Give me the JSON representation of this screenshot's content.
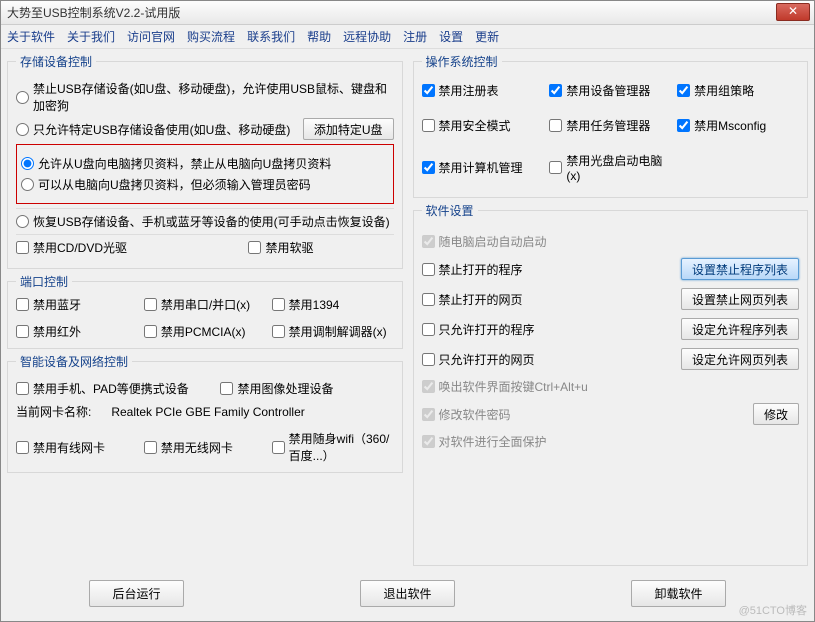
{
  "window": {
    "title": "大势至USB控制系统V2.2-试用版"
  },
  "menu": [
    "关于软件",
    "关于我们",
    "访问官网",
    "购买流程",
    "联系我们",
    "帮助",
    "远程协助",
    "注册",
    "设置",
    "更新"
  ],
  "storage": {
    "legend": "存储设备控制",
    "r1": "禁止USB存储设备(如U盘、移动硬盘)，允许使用USB鼠标、键盘和加密狗",
    "r2": "只允许特定USB存储设备使用(如U盘、移动硬盘)",
    "btn_add": "添加特定U盘",
    "r3": "允许从U盘向电脑拷贝资料，禁止从电脑向U盘拷贝资料",
    "r4": "可以从电脑向U盘拷贝资料，但必须输入管理员密码",
    "r5": "恢复USB存储设备、手机或蓝牙等设备的使用(可手动点击恢复设备)",
    "c1": "禁用CD/DVD光驱",
    "c2": "禁用软驱"
  },
  "port": {
    "legend": "端口控制",
    "items": [
      "禁用蓝牙",
      "禁用串口/并口(x)",
      "禁用1394",
      "禁用红外",
      "禁用PCMCIA(x)",
      "禁用调制解调器(x)"
    ]
  },
  "smart": {
    "legend": "智能设备及网络控制",
    "c1": "禁用手机、PAD等便携式设备",
    "c2": "禁用图像处理设备",
    "nic_label": "当前网卡名称:",
    "nic_value": "Realtek PCIe GBE Family Controller",
    "n1": "禁用有线网卡",
    "n2": "禁用无线网卡",
    "n3": "禁用随身wifi（360/百度...）"
  },
  "os": {
    "legend": "操作系统控制",
    "items": [
      "禁用注册表",
      "禁用设备管理器",
      "禁用组策略",
      "禁用安全模式",
      "禁用任务管理器",
      "禁用Msconfig",
      "禁用计算机管理",
      "禁用光盘启动电脑(x)"
    ],
    "checked": [
      true,
      true,
      true,
      false,
      false,
      true,
      true,
      false
    ]
  },
  "sw": {
    "legend": "软件设置",
    "autostart": "随电脑启动自动启动",
    "forbid_prog": "禁止打开的程序",
    "btn_forbid_prog": "设置禁止程序列表",
    "forbid_page": "禁止打开的网页",
    "btn_forbid_page": "设置禁止网页列表",
    "allow_prog": "只允许打开的程序",
    "btn_allow_prog": "设定允许程序列表",
    "allow_page": "只允许打开的网页",
    "btn_allow_page": "设定允许网页列表",
    "hotkey": "唤出软件界面按键Ctrl+Alt+u",
    "password": "修改软件密码",
    "btn_password": "修改",
    "protect": "对软件进行全面保护"
  },
  "footer": {
    "runbg": "后台运行",
    "exit": "退出软件",
    "uninstall": "卸载软件"
  },
  "watermark": "@51CTO博客"
}
